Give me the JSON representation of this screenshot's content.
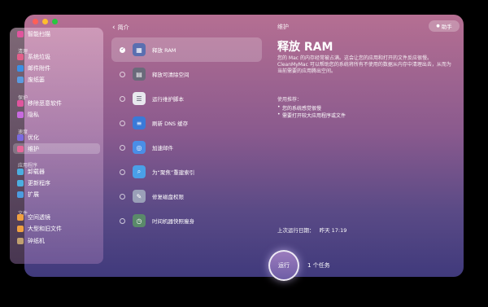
{
  "window": {
    "traffic_colors": [
      "#ff5f57",
      "#ffbd2e",
      "#28c840"
    ]
  },
  "sidebar": {
    "items": [
      {
        "label": "智能扫描",
        "icon": "smart-scan-icon",
        "color": "#e0559e"
      },
      {
        "label": "系统垃圾",
        "icon": "system-junk-icon",
        "color": "#e25f8a"
      },
      {
        "label": "邮件附件",
        "icon": "mail-attachments-icon",
        "color": "#3b8fe6"
      },
      {
        "label": "废纸篓",
        "icon": "trash-bins-icon",
        "color": "#5b9be0"
      },
      {
        "label": "移除恶意软件",
        "icon": "malware-removal-icon",
        "color": "#e0559e"
      },
      {
        "label": "隐私",
        "icon": "privacy-icon",
        "color": "#c86adf"
      },
      {
        "label": "优化",
        "icon": "optimization-icon",
        "color": "#7a6ae0"
      },
      {
        "label": "维护",
        "icon": "maintenance-icon",
        "color": "#e8679a"
      },
      {
        "label": "卸载器",
        "icon": "uninstaller-icon",
        "color": "#4caee0"
      },
      {
        "label": "更新程序",
        "icon": "updater-icon",
        "color": "#4caee0"
      },
      {
        "label": "扩展",
        "icon": "extensions-icon",
        "color": "#4c9ce0"
      },
      {
        "label": "空间透镜",
        "icon": "space-lens-icon",
        "color": "#f0a040"
      },
      {
        "label": "大型和旧文件",
        "icon": "large-old-files-icon",
        "color": "#f0a040"
      },
      {
        "label": "碎纸机",
        "icon": "shredder-icon",
        "color": "#c0a070"
      }
    ],
    "groups": [
      "清理",
      "保护",
      "速度",
      "应用程序",
      "文件"
    ],
    "active_label": "维护"
  },
  "header": {
    "back_label": "简介",
    "title": "维护",
    "help_label": "助手"
  },
  "tasks": [
    {
      "label": "释放 RAM",
      "checked": true,
      "icon": "ram-icon",
      "color": "#5a6fb0"
    },
    {
      "label": "释放可清除空间",
      "checked": false,
      "icon": "purgeable-space-icon",
      "color": "#6a6a7a"
    },
    {
      "label": "运行维护脚本",
      "checked": false,
      "icon": "maintenance-script-icon",
      "color": "#e8e8ee"
    },
    {
      "label": "刷新 DNS 缓存",
      "checked": false,
      "icon": "dns-icon",
      "color": "#3a7ad8"
    },
    {
      "label": "加速邮件",
      "checked": false,
      "icon": "mail-speedup-icon",
      "color": "#4a8ee6"
    },
    {
      "label": "为“聚焦”重建索引",
      "checked": false,
      "icon": "spotlight-reindex-icon",
      "color": "#4aa0e8"
    },
    {
      "label": "修复磁盘权限",
      "checked": false,
      "icon": "repair-permissions-icon",
      "color": "#9aa0b8"
    },
    {
      "label": "时间机器快照瘦身",
      "checked": false,
      "icon": "time-machine-icon",
      "color": "#5a8a6a"
    }
  ],
  "detail": {
    "title": "释放 RAM",
    "description": "您的 Mac 的内存经常被占满。这会让您的应用和打开的文件反应很慢。CleanMyMac 可以帮助您的系统将所有不使用的数据从内存中清理出去，从而为当前需要的应用腾出空间。",
    "recommended_heading": "使用推荐：",
    "recommended": [
      "您的系统感觉很慢",
      "需要打开较大应用程序或文件"
    ],
    "last_run_label": "上次运行日期：",
    "last_run_value": "昨天 17:19"
  },
  "footer": {
    "run_label": "运行",
    "task_count": "1 个任务"
  }
}
